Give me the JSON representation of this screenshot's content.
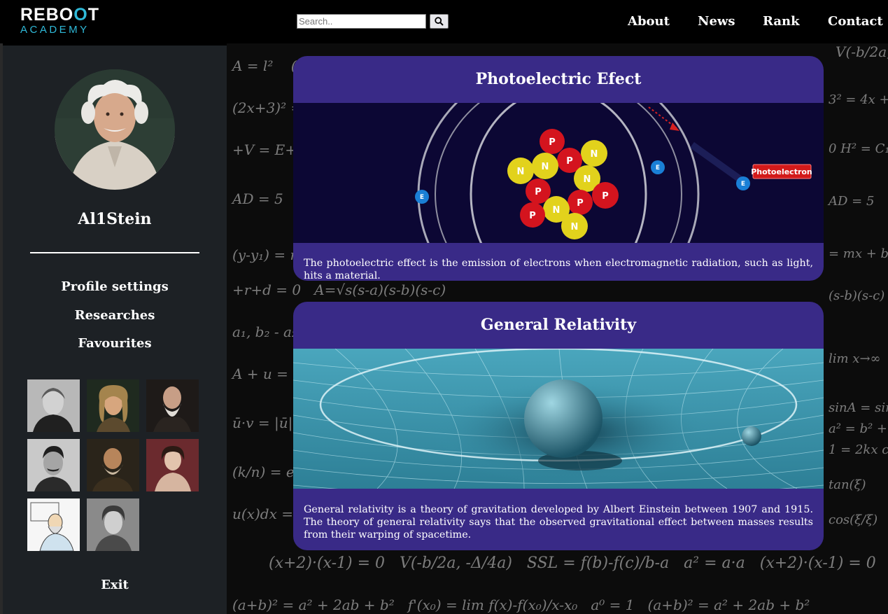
{
  "header": {
    "logo_top_1": "REBO",
    "logo_top_power": "O",
    "logo_top_2": "T",
    "logo_bottom": "ACADEMY",
    "search_placeholder": "Search..",
    "nav": [
      {
        "label": "About"
      },
      {
        "label": "News"
      },
      {
        "label": "Rank"
      },
      {
        "label": "Contact"
      }
    ]
  },
  "sidebar": {
    "username": "Al1Stein",
    "links": [
      {
        "label": "Profile settings"
      },
      {
        "label": "Researches"
      },
      {
        "label": "Favourites"
      }
    ],
    "favourites": [
      {
        "icon": "scientist-portrait-1"
      },
      {
        "icon": "scientist-portrait-2"
      },
      {
        "icon": "scientist-portrait-3"
      },
      {
        "icon": "scientist-portrait-4"
      },
      {
        "icon": "scientist-portrait-5"
      },
      {
        "icon": "scientist-portrait-6"
      },
      {
        "icon": "scientist-portrait-7"
      },
      {
        "icon": "scientist-portrait-8"
      }
    ],
    "exit_label": "Exit"
  },
  "cards": [
    {
      "title": "Photoelectric Efect",
      "image_label": "Photoelectron",
      "nucleus_letters": [
        "P",
        "N"
      ],
      "electron_letter": "E",
      "text": "The photoelectric effect is the emission of electrons when electromagnetic radiation, such as light, hits a material."
    },
    {
      "title": "General Relativity",
      "text": "General relativity is a theory of gravitation developed by Albert Einstein between 1907 and 1915. The theory of general relativity says that the observed gravitational effect between masses results from their warping of spacetime."
    }
  ],
  "colors": {
    "accent": "#2fb9d8",
    "card_bg": "#392a87",
    "sidebar_bg": "#1d2125",
    "page_bg": "#000000"
  }
}
